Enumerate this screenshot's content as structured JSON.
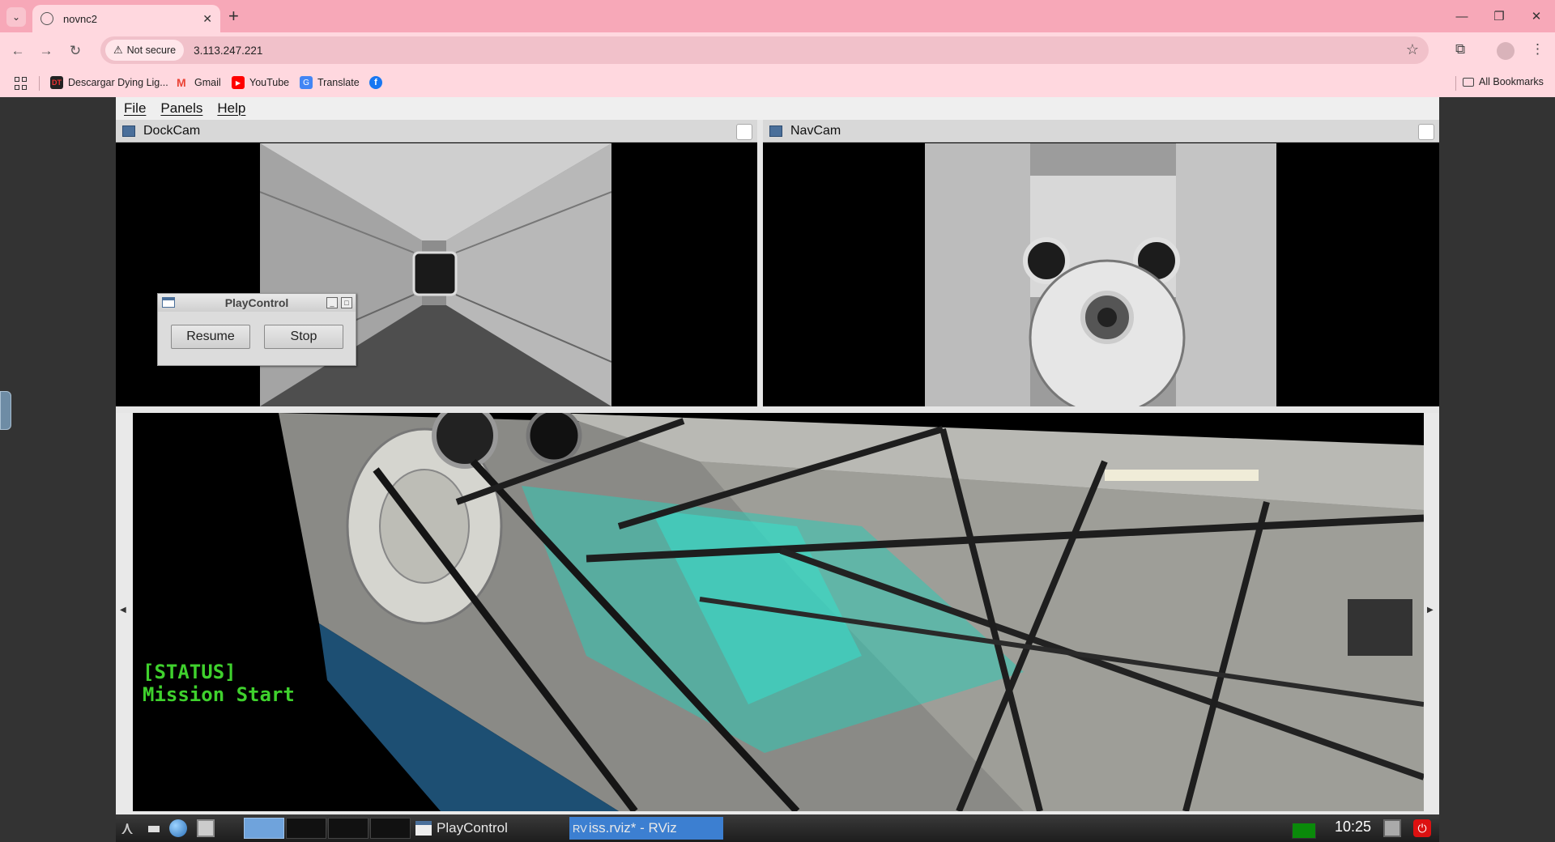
{
  "browser": {
    "tab_title": "novnc2",
    "tab_close": "✕",
    "new_tab": "+",
    "security_label": "Not secure",
    "url": "3.113.247.221",
    "bookmarks": [
      {
        "label": "Descargar Dying Lig...",
        "color": "#c62828"
      },
      {
        "label": "Gmail",
        "color": "#ea4335"
      },
      {
        "label": "YouTube",
        "color": "#ff0000"
      },
      {
        "label": "Translate",
        "color": "#4285f4"
      },
      {
        "label": "",
        "color": "#1877f2"
      }
    ],
    "all_bookmarks": "All Bookmarks"
  },
  "rviz": {
    "menu": [
      "File",
      "Panels",
      "Help"
    ],
    "panels": [
      {
        "title": "DockCam"
      },
      {
        "title": "NavCam"
      }
    ],
    "status_line1": "[STATUS]",
    "status_line2": "Mission Start"
  },
  "dialog": {
    "title": "PlayControl",
    "resume_label": "Resume",
    "stop_label": "Stop"
  },
  "taskbar": {
    "playcontrol_label": "PlayControl",
    "rviz_label": "iss.rviz* - RViz",
    "rviz_prefix": "RV",
    "clock": "10:25"
  },
  "colors": {
    "browser_accent": "#f7a8b8",
    "status_text": "#3fd12d",
    "active_task": "#3c7fd1"
  }
}
